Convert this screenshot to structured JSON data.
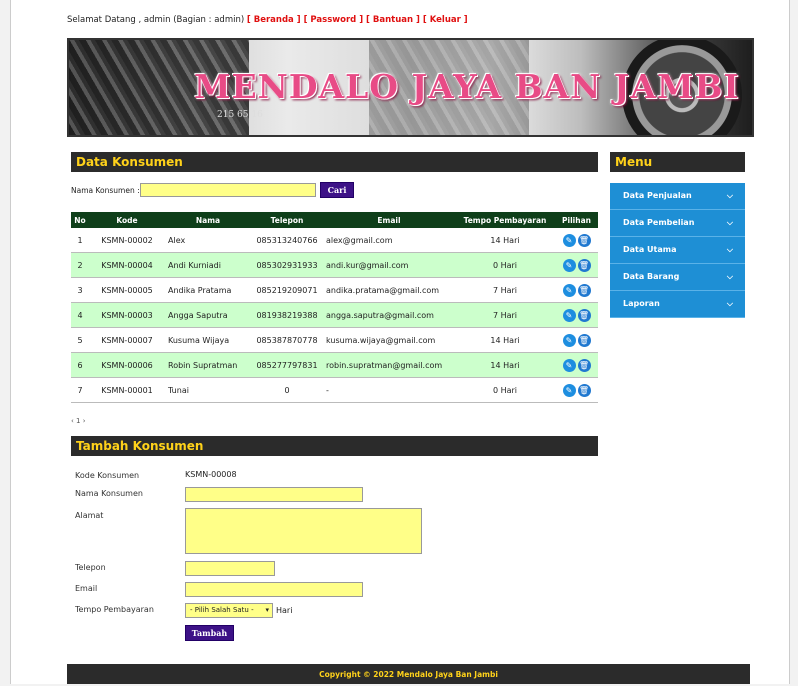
{
  "topbar": {
    "greeting": "Selamat Datang , admin (Bagian : admin) ",
    "links": [
      "[ Beranda ]",
      " [ Password ]",
      " [ Bantuan ]",
      " [ Keluar ]"
    ]
  },
  "banner": {
    "title": "MENDALO JAYA BAN JAMBI",
    "tire_text": "215 65 16"
  },
  "konsumen": {
    "heading": "Data Konsumen",
    "search_label": "Nama Konsumen :",
    "search_value": "",
    "search_button": "Cari",
    "columns": [
      "No",
      "Kode",
      "Nama",
      "Telepon",
      "Email",
      "Tempo Pembayaran",
      "Pilihan"
    ],
    "rows": [
      [
        "1",
        "KSMN-00002",
        "Alex",
        "085313240766",
        "alex@gmail.com",
        "14 Hari"
      ],
      [
        "2",
        "KSMN-00004",
        "Andi Kurniadi",
        "085302931933",
        "andi.kur@gmail.com",
        "0 Hari"
      ],
      [
        "3",
        "KSMN-00005",
        "Andika Pratama",
        "085219209071",
        "andika.pratama@gmail.com",
        "7 Hari"
      ],
      [
        "4",
        "KSMN-00003",
        "Angga Saputra",
        "081938219388",
        "angga.saputra@gmail.com",
        "7 Hari"
      ],
      [
        "5",
        "KSMN-00007",
        "Kusuma Wijaya",
        "085387870778",
        "kusuma.wijaya@gmail.com",
        "14 Hari"
      ],
      [
        "6",
        "KSMN-00006",
        "Robin Supratman",
        "085277797831",
        "robin.supratman@gmail.com",
        "14 Hari"
      ],
      [
        "7",
        "KSMN-00001",
        "Tunai",
        "0",
        "-",
        "0 Hari"
      ]
    ],
    "icons": {
      "edit": "pencil-icon",
      "delete": "trash-icon"
    },
    "pagination": "‹ 1 ›"
  },
  "menu": {
    "heading": "Menu",
    "items": [
      "Data Penjualan",
      "Data Pembelian",
      "Data Utama",
      "Data Barang",
      "Laporan"
    ]
  },
  "tambah": {
    "heading": "Tambah Konsumen",
    "kode_label": "Kode Konsumen",
    "kode_value": "KSMN-00008",
    "nama_label": "Nama Konsumen",
    "alamat_label": "Alamat",
    "telepon_label": "Telepon",
    "email_label": "Email",
    "tempo_label": "Tempo Pembayaran",
    "tempo_selected": "- Pilih Salah Satu -",
    "tempo_suffix": "Hari",
    "submit": "Tambah"
  },
  "footer": {
    "copyright": "Copyright © 2022 Mendalo Jaya Ban Jambi"
  },
  "colors": {
    "header_bar": "#2b2b2b",
    "heading_text": "#ffd21a",
    "table_head": "#0f3f1a",
    "alt_row": "#ccffcc",
    "input_bg": "#ffff88",
    "menu_bg": "#1e8fd5",
    "button": "#3d1287",
    "link_red": "#e01010"
  }
}
